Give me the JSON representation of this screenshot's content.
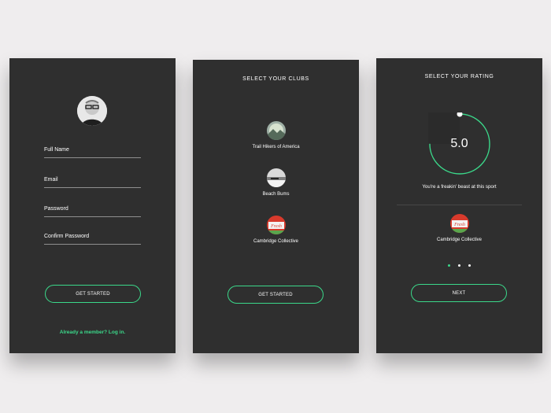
{
  "colors": {
    "accent": "#3bd88a",
    "background": "#efedee",
    "panel": "#2f2f2f"
  },
  "signup": {
    "fields": [
      {
        "label": "Full Name"
      },
      {
        "label": "Email"
      },
      {
        "label": "Password"
      },
      {
        "label": "Confirm Password"
      }
    ],
    "button_label": "GET STARTED",
    "login_link": "Already a member? Log in."
  },
  "clubs": {
    "title": "SELECT YOUR CLUBS",
    "items": [
      {
        "name": "Trail Hikers of America",
        "icon": "mountain-icon"
      },
      {
        "name": "Beach Bums",
        "icon": "beach-icon"
      },
      {
        "name": "Cambridge Collective",
        "icon": "fresh-badge-icon"
      }
    ],
    "button_label": "GET STARTED"
  },
  "rating": {
    "title": "SELECT YOUR RATING",
    "value": "5.0",
    "value_fraction": 0.75,
    "message": "You're a freakin' beast at this sport",
    "club_name": "Cambridge Collective",
    "badge_text": "Fresh",
    "pagination_active": 0,
    "button_label": "NEXT"
  }
}
